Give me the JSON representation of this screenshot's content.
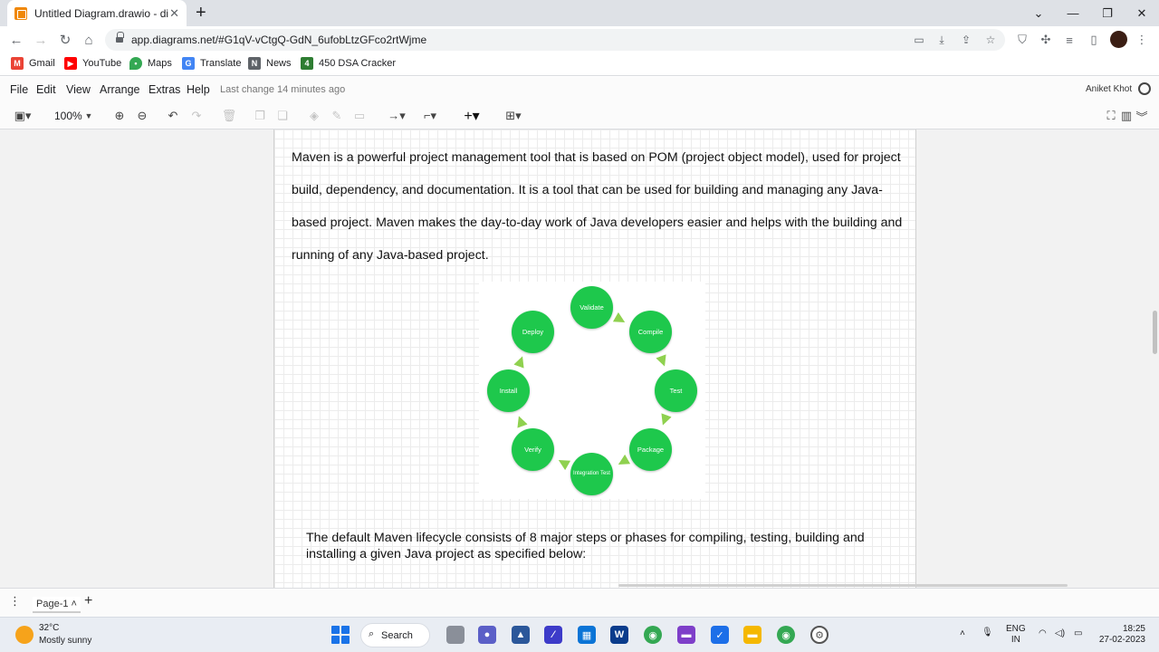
{
  "browser": {
    "tab_title": "Untitled Diagram.drawio - diagra",
    "url": "app.diagrams.net/#G1qV-vCtgQ-GdN_6ufobLtzGFco2rtWjme",
    "bookmarks": [
      {
        "label": "Gmail",
        "color": "#ea4335",
        "icon": "gmail-icon"
      },
      {
        "label": "YouTube",
        "color": "#ff0000",
        "icon": "youtube-icon"
      },
      {
        "label": "Maps",
        "color": "#34a853",
        "icon": "maps-icon"
      },
      {
        "label": "Translate",
        "color": "#4285f4",
        "icon": "translate-icon"
      },
      {
        "label": "News",
        "color": "#5f6368",
        "icon": "news-icon"
      },
      {
        "label": "450 DSA Cracker",
        "color": "#2e7d32",
        "icon_text": "4",
        "icon": "dsa-icon"
      }
    ]
  },
  "drawio": {
    "menus": [
      "File",
      "Edit",
      "View",
      "Arrange",
      "Extras",
      "Help"
    ],
    "last_change": "Last change 14 minutes ago",
    "user_name": "Aniket Khot",
    "zoom": "100%",
    "page_tab": "Page-1"
  },
  "content": {
    "paragraph1": "Maven is a powerful project management tool that is based on POM (project object model), used for project build, dependency, and documentation. It is a tool that can be used for building and managing any Java-based project. Maven makes the day-to-day work of Java developers easier and helps with the building and running of any Java-based project.",
    "phases": [
      "Validate",
      "Compile",
      "Test",
      "Package",
      "Integration Test",
      "Verify",
      "Install",
      "Deploy"
    ],
    "paragraph2": "The default Maven lifecycle consists of 8 major steps or phases for compiling, testing, building and installing a given Java project as specified below:",
    "phase_color": "#1ec84c",
    "arrow_color": "#8fd14f"
  },
  "taskbar": {
    "temperature": "32°C",
    "condition": "Mostly sunny",
    "search_label": "Search",
    "lang_line1": "ENG",
    "lang_line2": "IN",
    "time": "18:25",
    "date": "27-02-2023"
  }
}
